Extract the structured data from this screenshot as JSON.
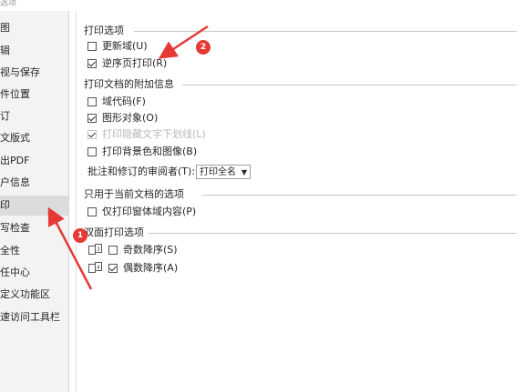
{
  "window": {
    "title": "选项"
  },
  "sidebar": {
    "items": [
      {
        "label": "图"
      },
      {
        "label": "辑"
      },
      {
        "label": "视与保存"
      },
      {
        "label": "件位置"
      },
      {
        "label": "订"
      },
      {
        "label": "文版式"
      },
      {
        "label": "出PDF"
      },
      {
        "label": "户信息"
      },
      {
        "label": "印"
      },
      {
        "label": "写检查"
      },
      {
        "label": "全性"
      },
      {
        "label": "任中心"
      },
      {
        "label": "定义功能区"
      },
      {
        "label": "速访问工具栏"
      }
    ],
    "active_index": 8
  },
  "print_options": {
    "title": "打印选项",
    "update_fields": {
      "label": "更新域(U)",
      "checked": false
    },
    "reverse_order": {
      "label": "逆序页打印(R)",
      "checked": true
    }
  },
  "extra_info": {
    "title": "打印文档的附加信息",
    "field_codes": {
      "label": "域代码(F)",
      "checked": false
    },
    "drawing_objects": {
      "label": "图形对象(O)",
      "checked": true
    },
    "hidden_text": {
      "label": "打印隐藏文字下划线(L)",
      "checked": true,
      "disabled": true
    },
    "background": {
      "label": "打印背景色和图像(B)",
      "checked": false
    },
    "reviewer_label": "批注和修订的审阅者(T):",
    "reviewer_value": "打印全名"
  },
  "current_doc": {
    "title": "只用于当前文档的选项",
    "form_data": {
      "label": "仅打印窗体域内容(P)",
      "checked": false
    }
  },
  "duplex": {
    "title": "双面打印选项",
    "odd_reverse": {
      "label": "奇数降序(S)",
      "checked": false
    },
    "even_reverse": {
      "label": "偶数降序(A)",
      "checked": true
    }
  },
  "annotations": {
    "badge1": "1",
    "badge2": "2",
    "color": "#e53935"
  }
}
